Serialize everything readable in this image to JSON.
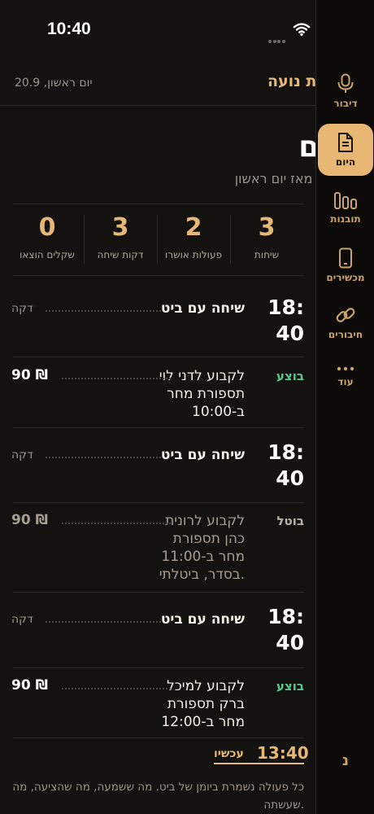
{
  "status_bar": {
    "time": "10:40"
  },
  "header": {
    "title": "מספרת נועה",
    "date": "יום ראשון, 20.9"
  },
  "page": {
    "title": "היום",
    "subtitle": "השבוע, מאז יום ראשון"
  },
  "stats": [
    {
      "value": "3",
      "label": "שיחות"
    },
    {
      "value": "2",
      "label": "פעולות אושרו"
    },
    {
      "value": "3",
      "label": "דקות שיחה"
    },
    {
      "value": "0",
      "label": "שקלים הוצאו"
    }
  ],
  "timeline": [
    {
      "kind": "call",
      "time_line1": "18:",
      "time_line2": "40",
      "title": "שיחה עם ביט",
      "meta": "דקה"
    },
    {
      "kind": "action",
      "status": "בוצע",
      "lines": [
        "לקבוע לדני לוי",
        "תספורת מחר",
        "ב-10:00"
      ],
      "price": "90 ₪"
    },
    {
      "kind": "call",
      "time_line1": "18:",
      "time_line2": "40",
      "title": "שיחה עם ביט",
      "meta": "דקה"
    },
    {
      "kind": "action",
      "status": "בוטל",
      "lines": [
        "לקבוע לרונית",
        "כהן תספורת",
        "מחר ב-11:00",
        "בסדר, ביטלתי."
      ],
      "price": "90 ₪"
    },
    {
      "kind": "call",
      "time_line1": "18:",
      "time_line2": "40",
      "title": "שיחה עם ביט",
      "meta": "דקה"
    },
    {
      "kind": "action",
      "status": "בוצע",
      "lines": [
        "לקבוע למיכל",
        "ברק תספורת",
        "מחר ב-12:00"
      ],
      "price": "90 ₪"
    }
  ],
  "now": {
    "time": "13:40",
    "label": "עכשיו"
  },
  "footer": {
    "text": "כל פעולה נשמרת ביומן של ביט. מה ששמעה, מה שהציעה, מה שעשתה."
  },
  "sidebar": {
    "items": [
      {
        "label": "דיבור",
        "icon": "microphone-icon"
      },
      {
        "label": "היום",
        "icon": "document-icon"
      },
      {
        "label": "תובנות",
        "icon": "bar-chart-icon"
      },
      {
        "label": "מכשירים",
        "icon": "phone-icon"
      },
      {
        "label": "חיבורים",
        "icon": "link-icon"
      },
      {
        "label": "עוד",
        "icon": "more-icon"
      }
    ],
    "bottom": "נ"
  },
  "colors": {
    "accent": "#e6b877",
    "background": "#141210",
    "done": "#5bc88b"
  }
}
